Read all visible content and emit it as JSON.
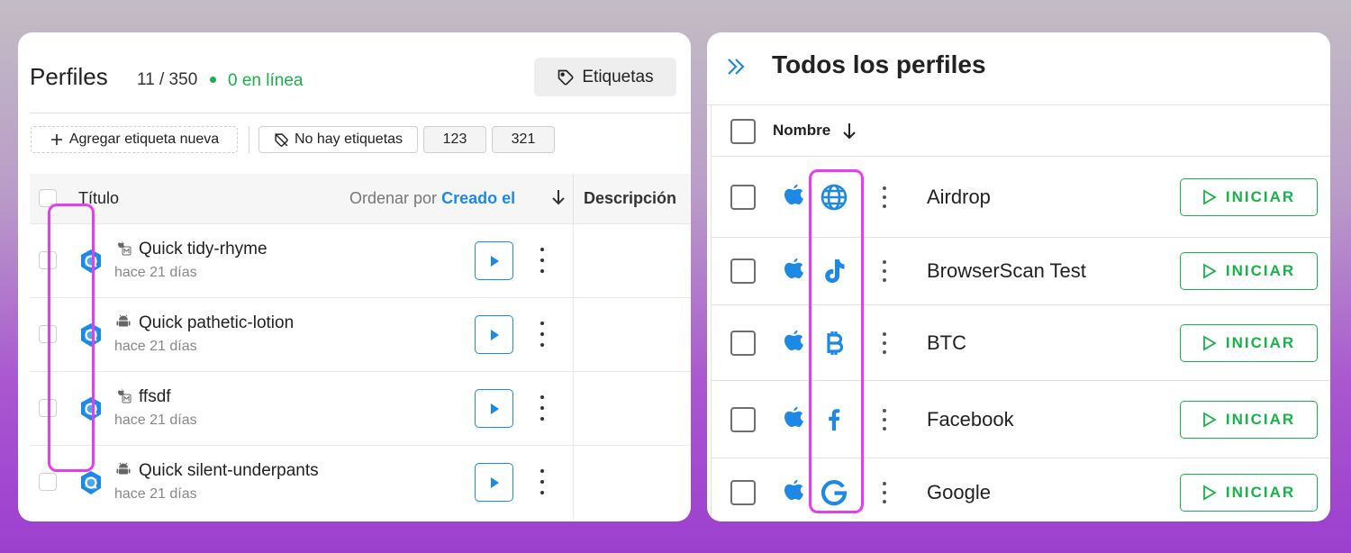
{
  "left_panel": {
    "title": "Perfiles",
    "count": "11 / 350",
    "online": "0 en línea",
    "tags_button": "Etiquetas",
    "chips": {
      "add_tag": "Agregar etiqueta nueva",
      "no_tags": "No hay etiquetas",
      "tag1": "123",
      "tag2": "321"
    },
    "table_header": {
      "title_col": "Título",
      "sort_prefix": "Ordenar por",
      "sort_field": "Creado el",
      "description_col": "Descripción"
    },
    "rows": [
      {
        "name": "Quick tidy-rhyme",
        "date": "hace 21 días",
        "os": "macos"
      },
      {
        "name": "Quick pathetic-lotion",
        "date": "hace 21 días",
        "os": "android"
      },
      {
        "name": "ffsdf",
        "date": "hace 21 días",
        "os": "macos"
      },
      {
        "name": "Quick silent-underpants",
        "date": "hace 21 días",
        "os": "android"
      }
    ]
  },
  "right_panel": {
    "title": "Todos los perfiles",
    "column_name": "Nombre",
    "start_label": "INICIAR",
    "rows": [
      {
        "name": "Airdrop",
        "icon": "globe-icon"
      },
      {
        "name": "BrowserScan Test",
        "icon": "tiktok-icon"
      },
      {
        "name": "BTC",
        "icon": "bitcoin-icon"
      },
      {
        "name": "Facebook",
        "icon": "facebook-icon"
      },
      {
        "name": "Google",
        "icon": "google-icon"
      }
    ]
  },
  "colors": {
    "accent_blue": "#1e88e5",
    "online_green": "#17b34a",
    "highlight_magenta": "#e43ef0"
  }
}
